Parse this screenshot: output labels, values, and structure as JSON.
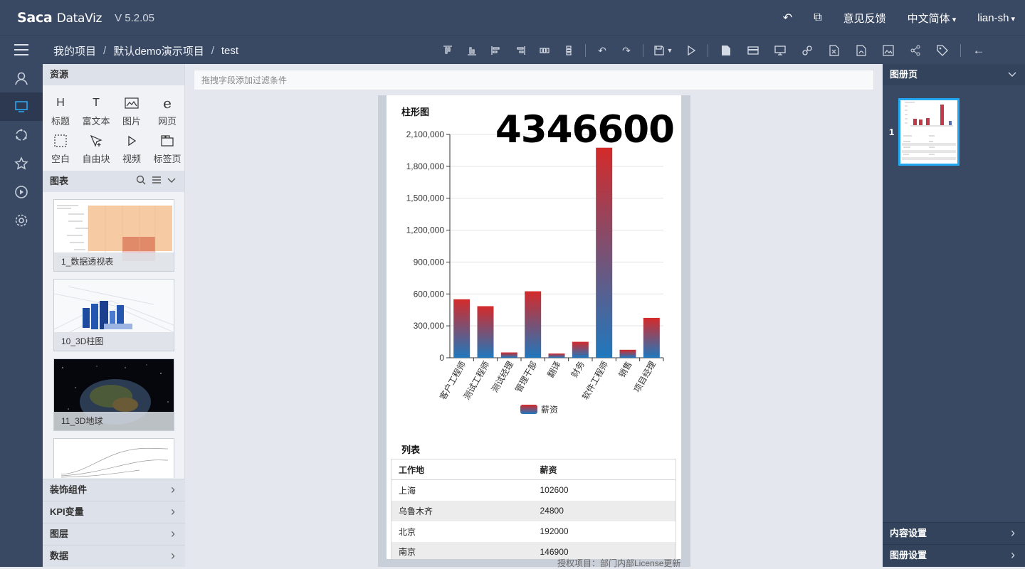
{
  "app": {
    "logo": "Saca",
    "logo_suffix": "DataViz",
    "version": "V 5.2.05",
    "feedback": "意见反馈",
    "language": "中文简体",
    "user": "lian-sh"
  },
  "breadcrumb": [
    "我的项目",
    "默认demo演示项目",
    "test"
  ],
  "breadcrumb_sep": "/",
  "resources": {
    "title": "资源",
    "items": [
      {
        "label": "标题",
        "icon": "heading-icon"
      },
      {
        "label": "富文本",
        "icon": "text-icon"
      },
      {
        "label": "图片",
        "icon": "image-icon"
      },
      {
        "label": "网页",
        "icon": "webpage-icon"
      },
      {
        "label": "空白",
        "icon": "blank-icon"
      },
      {
        "label": "自由块",
        "icon": "free-block-icon"
      },
      {
        "label": "视频",
        "icon": "video-icon"
      },
      {
        "label": "标签页",
        "icon": "tab-page-icon"
      }
    ]
  },
  "charts_panel": {
    "title": "图表",
    "items": [
      "1_数据透视表",
      "10_3D柱图",
      "11_3D地球",
      ""
    ]
  },
  "accordion": [
    "装饰组件",
    "KPI变量",
    "图层",
    "数据"
  ],
  "filter_placeholder": "拖拽字段添加过滤条件",
  "canvas": {
    "kpi_value": "4346600",
    "list_title": "列表",
    "table": {
      "headers": [
        "工作地",
        "薪资"
      ],
      "rows": [
        [
          "上海",
          "102600"
        ],
        [
          "乌鲁木齐",
          "24800"
        ],
        [
          "北京",
          "192000"
        ],
        [
          "南京",
          "146900"
        ]
      ]
    },
    "license": "授权项目：部门内部License更新"
  },
  "chart_data": {
    "type": "bar",
    "title": "柱形图",
    "categories": [
      "客户工程师",
      "测试工程师",
      "测试经理",
      "管理干部",
      "翻译",
      "财务",
      "软件工程师",
      "销售",
      "项目经理"
    ],
    "series": [
      {
        "name": "薪资",
        "values": [
          550000,
          485000,
          50000,
          625000,
          40000,
          150000,
          1975000,
          75000,
          375000
        ]
      }
    ],
    "ylim": [
      0,
      2100000
    ],
    "yticks": [
      "0",
      "300,000",
      "600,000",
      "900,000",
      "1,200,000",
      "1,500,000",
      "1,800,000",
      "2,100,000"
    ],
    "gradient_colors": [
      "#d42a2a",
      "#1f78be"
    ],
    "legend": "bottom-center",
    "grid": true
  },
  "right_panel": {
    "title": "图册页",
    "page_number": "1",
    "content_settings": "内容设置",
    "album_settings": "图册设置"
  }
}
